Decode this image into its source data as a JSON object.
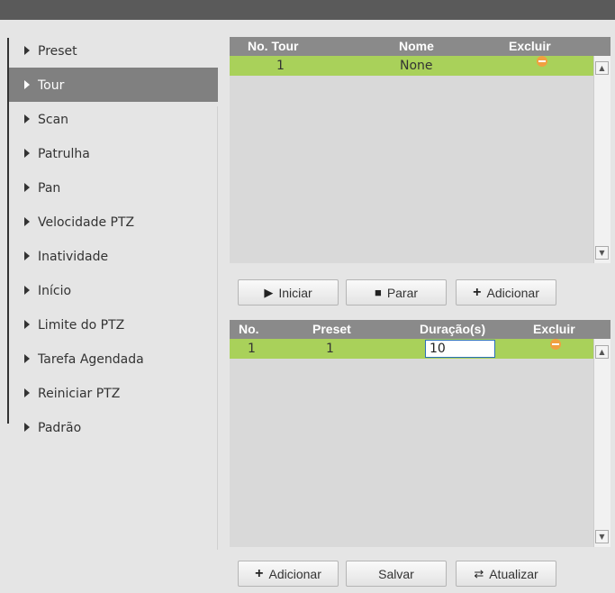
{
  "sidebar": {
    "items": [
      {
        "label": "Preset"
      },
      {
        "label": "Tour"
      },
      {
        "label": "Scan"
      },
      {
        "label": "Patrulha"
      },
      {
        "label": "Pan"
      },
      {
        "label": "Velocidade PTZ"
      },
      {
        "label": "Inatividade"
      },
      {
        "label": "Início"
      },
      {
        "label": "Limite do PTZ"
      },
      {
        "label": "Tarefa Agendada"
      },
      {
        "label": "Reiniciar PTZ"
      },
      {
        "label": "Padrão"
      }
    ],
    "active": "Tour"
  },
  "tour_table": {
    "columns": [
      "No. Tour",
      "Nome",
      "Excluir"
    ],
    "rows": [
      {
        "no": "1",
        "nome": "None"
      }
    ]
  },
  "tour_buttons": {
    "start": "Iniciar",
    "stop": "Parar",
    "add": "Adicionar"
  },
  "preset_table": {
    "columns": [
      "No.",
      "Preset",
      "Duração(s)",
      "Excluir"
    ],
    "rows": [
      {
        "no": "1",
        "preset": "1",
        "duration": "10"
      }
    ]
  },
  "bottom_buttons": {
    "add": "Adicionar",
    "save": "Salvar",
    "refresh": "Atualizar"
  },
  "colors": {
    "row_highlight": "#a9d15a",
    "active_item": "#808080",
    "header": "#8a8a8a",
    "delete_icon": "#f0a040"
  }
}
